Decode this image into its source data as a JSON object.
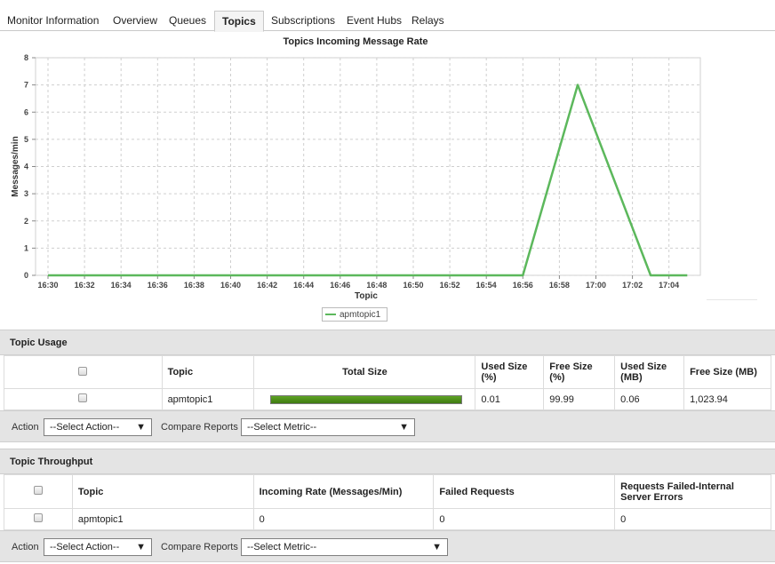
{
  "tabs": [
    {
      "label": "Monitor Information"
    },
    {
      "label": "Overview"
    },
    {
      "label": "Queues"
    },
    {
      "label": "Topics",
      "active": true
    },
    {
      "label": "Subscriptions"
    },
    {
      "label": "Event Hubs"
    },
    {
      "label": "Relays"
    }
  ],
  "chart_data": {
    "type": "line",
    "title": "Topics Incoming Message Rate",
    "xlabel": "Topic",
    "ylabel": "Messages/min",
    "ylim": [
      0,
      8
    ],
    "yticks": [
      "0",
      "1",
      "2",
      "3",
      "4",
      "5",
      "6",
      "7",
      "8"
    ],
    "x_tick_labels": [
      "16:30",
      "16:32",
      "16:34",
      "16:36",
      "16:38",
      "16:40",
      "16:42",
      "16:44",
      "16:46",
      "16:48",
      "16:50",
      "16:52",
      "16:54",
      "16:56",
      "16:58",
      "17:00",
      "17:02",
      "17:04"
    ],
    "grid": true,
    "legend": "bottom",
    "series": [
      {
        "name": "apmtopic1",
        "color": "#5cb85c",
        "x": [
          "16:30",
          "16:56",
          "16:59",
          "17:03",
          "17:05"
        ],
        "values": [
          0,
          0,
          7,
          0,
          0
        ]
      }
    ]
  },
  "usage": {
    "title": "Topic Usage",
    "headers": {
      "topic": "Topic",
      "total_size": "Total Size",
      "used_pct": "Used Size (%)",
      "free_pct": "Free Size  (%)",
      "used_mb": "Used Size (MB)",
      "free_mb": "Free Size  (MB)"
    },
    "rows": [
      {
        "topic": "apmtopic1",
        "used_pct": "0.01",
        "free_pct": "99.99",
        "used_mb": "0.06",
        "free_mb": "1,023.94",
        "fill_fraction": 0.9999
      }
    ],
    "action_label": "Action",
    "action_value": "--Select Action--",
    "compare_label": "Compare Reports",
    "compare_value": "--Select Metric--"
  },
  "throughput": {
    "title": "Topic Throughput",
    "headers": {
      "topic": "Topic",
      "incoming": "Incoming Rate  (Messages/Min)",
      "failed": "Failed Requests",
      "failed_internal": "Requests Failed-Internal Server Errors"
    },
    "rows": [
      {
        "topic": "apmtopic1",
        "incoming": "0",
        "failed": "0",
        "failed_internal": "0"
      }
    ],
    "action_label": "Action",
    "action_value": "--Select Action--",
    "compare_label": "Compare Reports",
    "compare_value": "--Select Metric--"
  }
}
